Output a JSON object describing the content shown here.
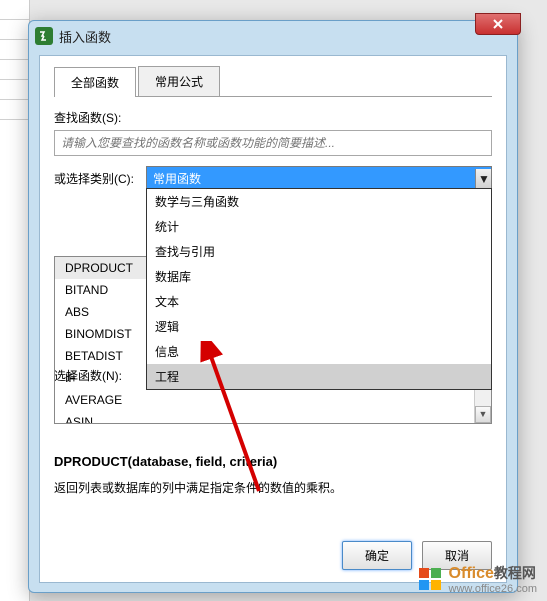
{
  "dialog": {
    "title": "插入函数",
    "tabs": [
      {
        "label": "全部函数",
        "active": true
      },
      {
        "label": "常用公式",
        "active": false
      }
    ],
    "search": {
      "label": "查找函数(S):",
      "placeholder": "请输入您要查找的函数名称或函数功能的简要描述..."
    },
    "category": {
      "label": "或选择类别(C):",
      "selected": "常用函数",
      "options": [
        "数学与三角函数",
        "统计",
        "查找与引用",
        "数据库",
        "文本",
        "逻辑",
        "信息",
        "工程"
      ],
      "highlighted_index": 7
    },
    "functionList": {
      "label": "选择函数(N):",
      "items": [
        "DPRODUCT",
        "BITAND",
        "ABS",
        "BINOMDIST",
        "BETADIST",
        "IF",
        "AVERAGE",
        "ASIN"
      ],
      "selected_index": 0
    },
    "signature": {
      "name": "DPRODUCT",
      "args": "(database, field, criteria)"
    },
    "description": "返回列表或数据库的列中满足指定条件的数值的乘积。",
    "buttons": {
      "ok": "确定",
      "cancel": "取消"
    }
  },
  "watermark": {
    "brand": "Office",
    "brand_cn": "教程网",
    "url": "www.office26.com"
  }
}
